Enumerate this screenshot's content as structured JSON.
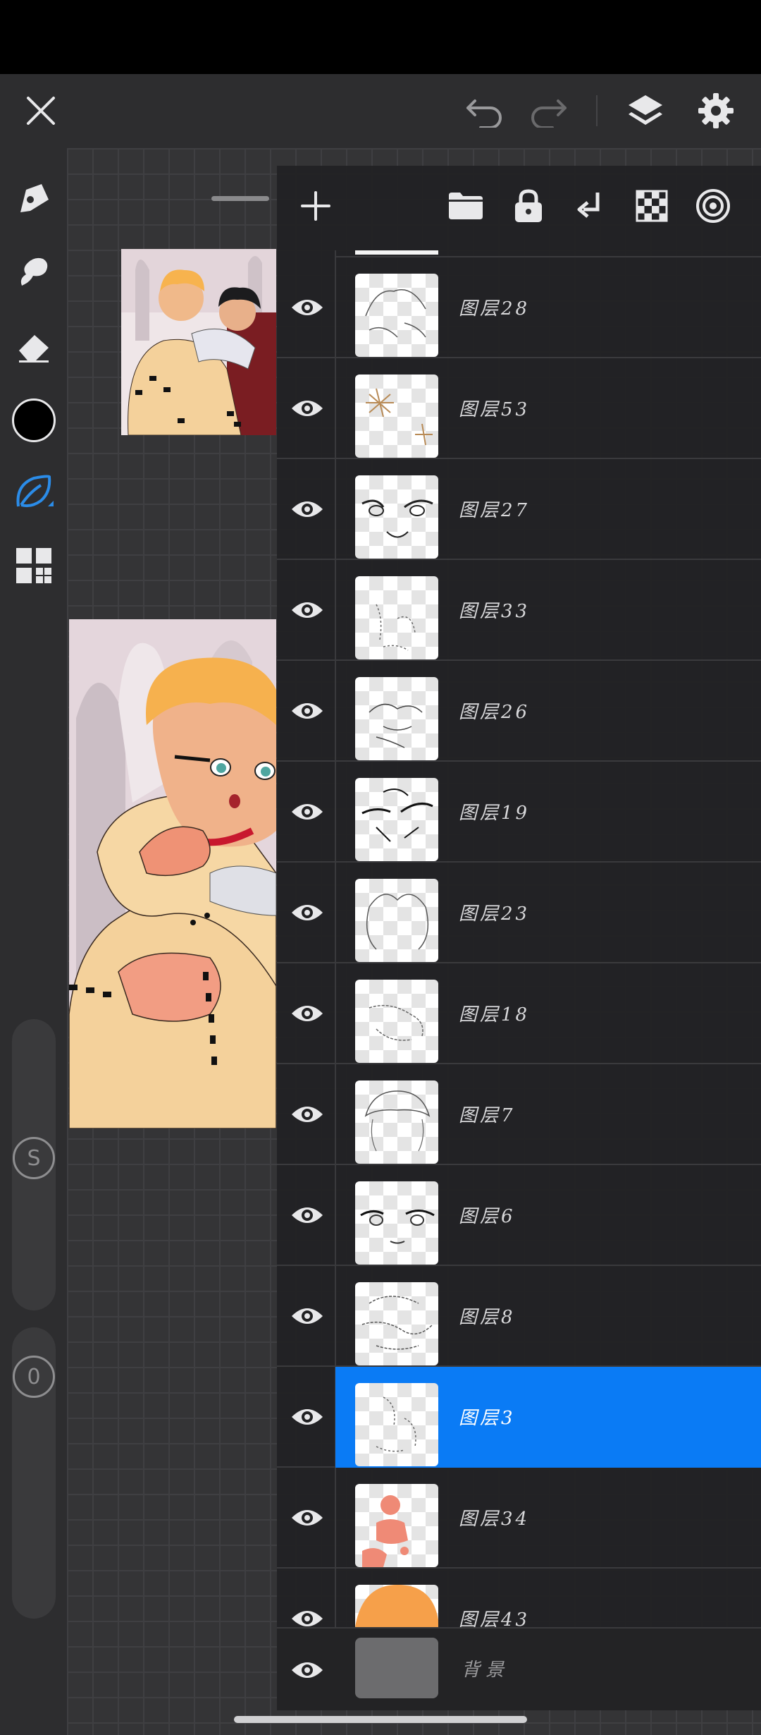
{
  "topbar": {
    "close_icon": "close-icon",
    "undo_icon": "undo-icon",
    "redo_icon": "redo-icon",
    "layers_icon": "layers-icon",
    "settings_icon": "gear-icon"
  },
  "tools": [
    "pen-icon",
    "smudge-icon",
    "eraser-icon",
    "color-swatch",
    "lasso-leaf-icon",
    "gallery-grid-icon"
  ],
  "colors": {
    "accent": "#0a7bf5",
    "current_color": "#000000",
    "panel_bg": "#212123"
  },
  "sliders": {
    "size_label": "S",
    "opacity_label": "0"
  },
  "layer_toolbar": [
    "add-layer-icon",
    "folder-icon",
    "lock-icon",
    "merge-down-icon",
    "transparency-icon",
    "reference-icon"
  ],
  "layers": [
    {
      "name": "图层28",
      "visible": true,
      "selected": false
    },
    {
      "name": "图层53",
      "visible": true,
      "selected": false
    },
    {
      "name": "图层27",
      "visible": true,
      "selected": false
    },
    {
      "name": "图层33",
      "visible": true,
      "selected": false
    },
    {
      "name": "图层26",
      "visible": true,
      "selected": false
    },
    {
      "name": "图层19",
      "visible": true,
      "selected": false
    },
    {
      "name": "图层23",
      "visible": true,
      "selected": false
    },
    {
      "name": "图层18",
      "visible": true,
      "selected": false
    },
    {
      "name": "图层7",
      "visible": true,
      "selected": false
    },
    {
      "name": "图层6",
      "visible": true,
      "selected": false
    },
    {
      "name": "图层8",
      "visible": true,
      "selected": false
    },
    {
      "name": "图层3",
      "visible": true,
      "selected": true
    },
    {
      "name": "图层34",
      "visible": true,
      "selected": false
    },
    {
      "name": "图层43",
      "visible": true,
      "selected": false
    }
  ],
  "background_layer": {
    "name": "背景",
    "visible": true
  }
}
